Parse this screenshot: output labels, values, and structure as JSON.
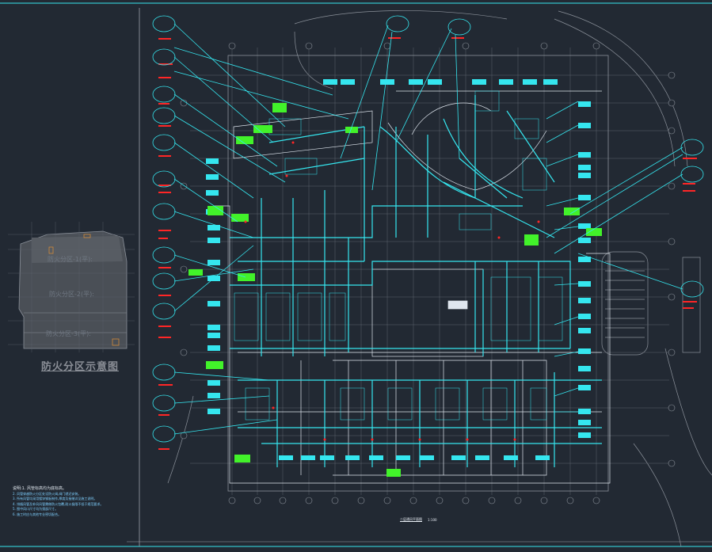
{
  "drawing": {
    "colors": {
      "background": "#222933",
      "cyan": "#35e6ef",
      "green": "#42f22a",
      "red": "#ff2626",
      "white": "#e8eef5",
      "gray": "#6f7782",
      "grid": "#5c636d"
    }
  },
  "keyplan": {
    "title": "防火分区示意图",
    "zone1_label": "防火分区-1(平):",
    "zone2_label": "防火分区-2(平):",
    "zone3_label": "防火分区-3(平):"
  },
  "plan": {
    "title": "二层通风平面图",
    "scale": "1:100"
  },
  "notes": {
    "heading": "说明:1. 风管标高均为底标高。",
    "lines": [
      "2. 风管穿越防火分区处设防火阀,阀门就近安装。",
      "3. 所有风管均采用镀锌钢板制作,厚度及接缝详见施工说明。",
      "4. 排烟风管及补风风管需做防火包覆,耐火极限不低于规范要求。",
      "5. 图中风口尺寸均为颈部尺寸。",
      "6. 施工时应与其他专业密切配合。"
    ]
  }
}
